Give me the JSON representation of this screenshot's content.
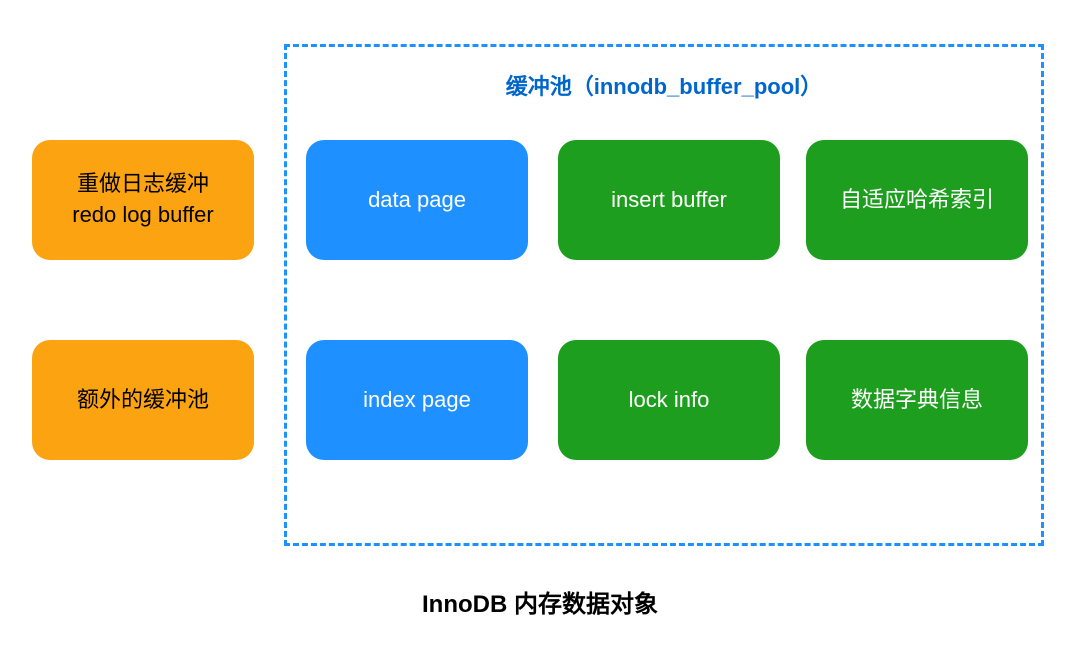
{
  "buffer_pool_title": "缓冲池（innodb_buffer_pool）",
  "caption": "InnoDB 内存数据对象",
  "left_blocks": {
    "redo_cn": "重做日志缓冲",
    "redo_en": "redo log buffer",
    "extra_pool": "额外的缓冲池"
  },
  "pool_blocks": {
    "data_page": "data page",
    "insert_buffer": "insert buffer",
    "adaptive_hash": "自适应哈希索引",
    "index_page": "index page",
    "lock_info": "lock info",
    "dict_info": "数据字典信息"
  }
}
